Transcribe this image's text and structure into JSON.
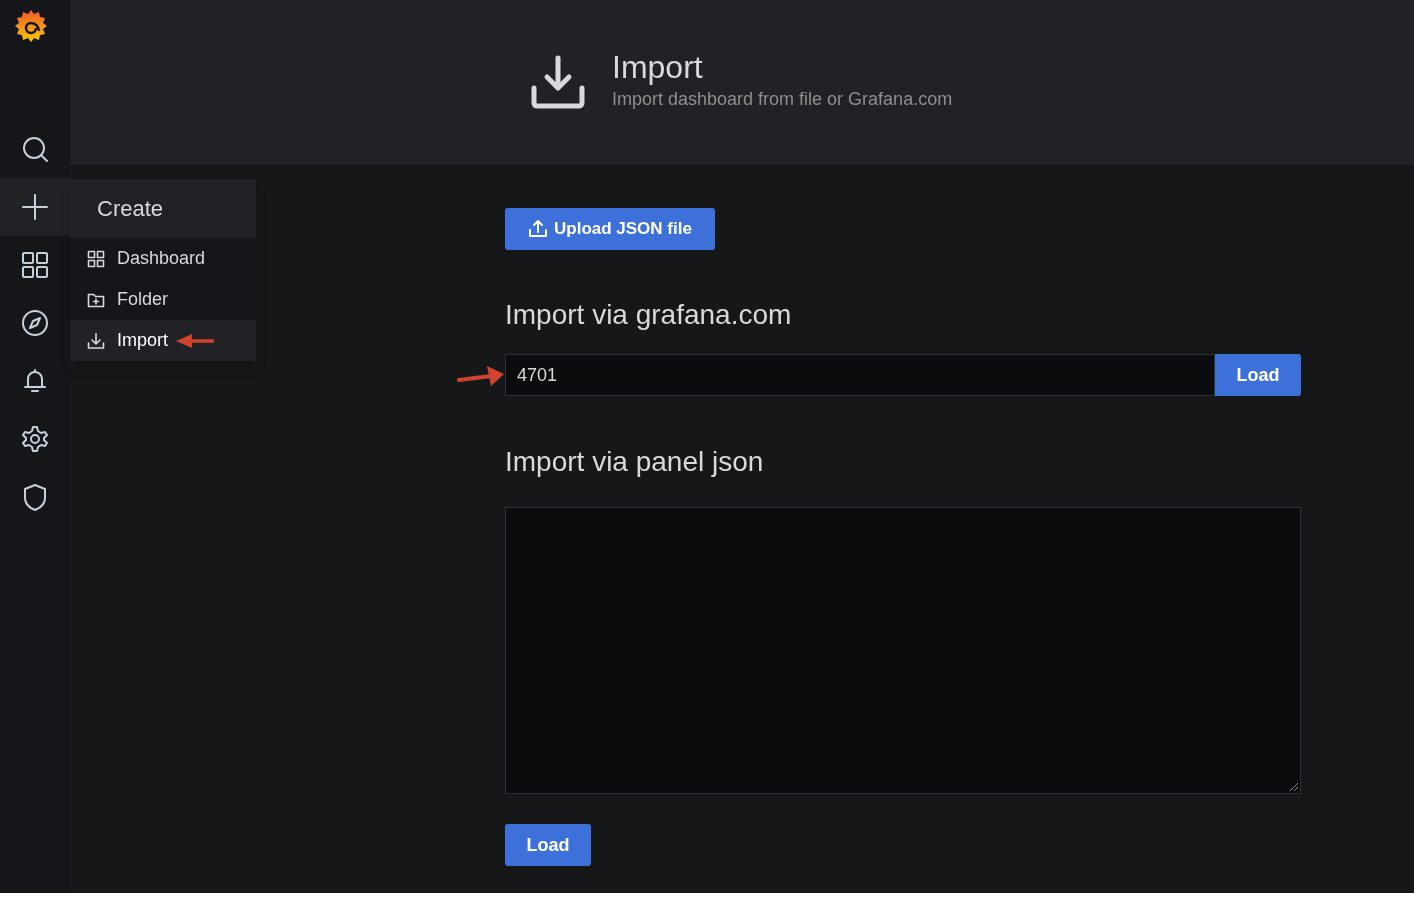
{
  "sidebar": {
    "items": [
      {
        "kind": "search",
        "selected": false
      },
      {
        "kind": "create",
        "selected": true
      },
      {
        "kind": "dashboards",
        "selected": false
      },
      {
        "kind": "explore",
        "selected": false
      },
      {
        "kind": "alerting",
        "selected": false
      },
      {
        "kind": "configuration",
        "selected": false
      },
      {
        "kind": "admin",
        "selected": false
      }
    ]
  },
  "create_menu": {
    "title": "Create",
    "items": [
      {
        "label": "Dashboard",
        "kind": "dashboard",
        "selected": false
      },
      {
        "label": "Folder",
        "kind": "folder",
        "selected": false
      },
      {
        "label": "Import",
        "kind": "import",
        "selected": true
      }
    ]
  },
  "page_header": {
    "title": "Import",
    "subtitle": "Import dashboard from file or Grafana.com"
  },
  "upload_button": "Upload JSON file",
  "grafana_com": {
    "heading": "Import via grafana.com",
    "value": "4701",
    "button": "Load"
  },
  "panel_json": {
    "heading": "Import via panel json",
    "button": "Load"
  }
}
